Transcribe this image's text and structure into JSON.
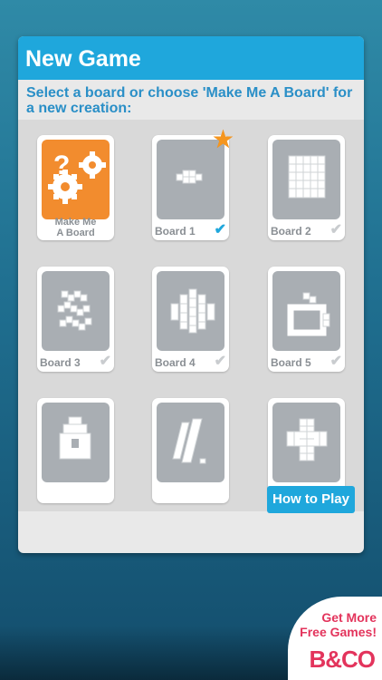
{
  "dialog": {
    "title": "New Game",
    "subtitle": "Select a board or choose 'Make Me A Board' for a new creation:"
  },
  "cards": [
    {
      "label_line1": "Make Me",
      "label_line2": "A Board",
      "icon": "gears-icon"
    },
    {
      "label": "Board 1",
      "selected": true,
      "favorite": true
    },
    {
      "label": "Board 2",
      "selected": false
    },
    {
      "label": "Board 3",
      "selected": false
    },
    {
      "label": "Board 4",
      "selected": false
    },
    {
      "label": "Board 5",
      "selected": false
    },
    {
      "label": "",
      "selected": false
    },
    {
      "label": "",
      "selected": false
    },
    {
      "label": "",
      "selected": false
    }
  ],
  "icons": {
    "check": "✔",
    "star": "★",
    "question": "?"
  },
  "buttons": {
    "how_to_play": "How to Play"
  },
  "promo": {
    "line1": "Get More",
    "line2": "Free Games!",
    "brand": "B&CO"
  },
  "colors": {
    "accent": "#1fa7dc",
    "make_me_board": "#f28c2e",
    "star": "#f5961f",
    "promo_brand": "#e3345c"
  }
}
